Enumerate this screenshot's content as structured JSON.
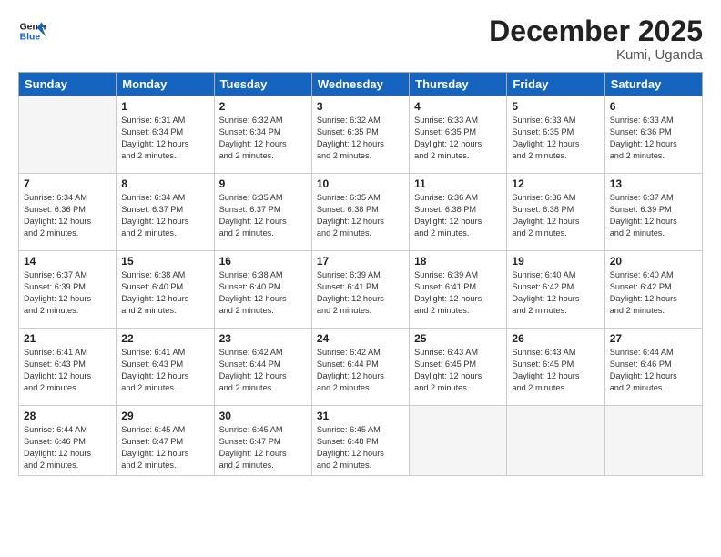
{
  "header": {
    "logo_line1": "General",
    "logo_line2": "Blue",
    "month_title": "December 2025",
    "location": "Kumi, Uganda"
  },
  "days_of_week": [
    "Sunday",
    "Monday",
    "Tuesday",
    "Wednesday",
    "Thursday",
    "Friday",
    "Saturday"
  ],
  "weeks": [
    [
      {
        "day": "",
        "empty": true
      },
      {
        "day": "1",
        "sunrise": "6:31 AM",
        "sunset": "6:34 PM",
        "daylight": "12 hours and 2 minutes."
      },
      {
        "day": "2",
        "sunrise": "6:32 AM",
        "sunset": "6:34 PM",
        "daylight": "12 hours and 2 minutes."
      },
      {
        "day": "3",
        "sunrise": "6:32 AM",
        "sunset": "6:35 PM",
        "daylight": "12 hours and 2 minutes."
      },
      {
        "day": "4",
        "sunrise": "6:33 AM",
        "sunset": "6:35 PM",
        "daylight": "12 hours and 2 minutes."
      },
      {
        "day": "5",
        "sunrise": "6:33 AM",
        "sunset": "6:35 PM",
        "daylight": "12 hours and 2 minutes."
      },
      {
        "day": "6",
        "sunrise": "6:33 AM",
        "sunset": "6:36 PM",
        "daylight": "12 hours and 2 minutes."
      }
    ],
    [
      {
        "day": "7",
        "sunrise": "6:34 AM",
        "sunset": "6:36 PM",
        "daylight": "12 hours and 2 minutes."
      },
      {
        "day": "8",
        "sunrise": "6:34 AM",
        "sunset": "6:37 PM",
        "daylight": "12 hours and 2 minutes."
      },
      {
        "day": "9",
        "sunrise": "6:35 AM",
        "sunset": "6:37 PM",
        "daylight": "12 hours and 2 minutes."
      },
      {
        "day": "10",
        "sunrise": "6:35 AM",
        "sunset": "6:38 PM",
        "daylight": "12 hours and 2 minutes."
      },
      {
        "day": "11",
        "sunrise": "6:36 AM",
        "sunset": "6:38 PM",
        "daylight": "12 hours and 2 minutes."
      },
      {
        "day": "12",
        "sunrise": "6:36 AM",
        "sunset": "6:38 PM",
        "daylight": "12 hours and 2 minutes."
      },
      {
        "day": "13",
        "sunrise": "6:37 AM",
        "sunset": "6:39 PM",
        "daylight": "12 hours and 2 minutes."
      }
    ],
    [
      {
        "day": "14",
        "sunrise": "6:37 AM",
        "sunset": "6:39 PM",
        "daylight": "12 hours and 2 minutes."
      },
      {
        "day": "15",
        "sunrise": "6:38 AM",
        "sunset": "6:40 PM",
        "daylight": "12 hours and 2 minutes."
      },
      {
        "day": "16",
        "sunrise": "6:38 AM",
        "sunset": "6:40 PM",
        "daylight": "12 hours and 2 minutes."
      },
      {
        "day": "17",
        "sunrise": "6:39 AM",
        "sunset": "6:41 PM",
        "daylight": "12 hours and 2 minutes."
      },
      {
        "day": "18",
        "sunrise": "6:39 AM",
        "sunset": "6:41 PM",
        "daylight": "12 hours and 2 minutes."
      },
      {
        "day": "19",
        "sunrise": "6:40 AM",
        "sunset": "6:42 PM",
        "daylight": "12 hours and 2 minutes."
      },
      {
        "day": "20",
        "sunrise": "6:40 AM",
        "sunset": "6:42 PM",
        "daylight": "12 hours and 2 minutes."
      }
    ],
    [
      {
        "day": "21",
        "sunrise": "6:41 AM",
        "sunset": "6:43 PM",
        "daylight": "12 hours and 2 minutes."
      },
      {
        "day": "22",
        "sunrise": "6:41 AM",
        "sunset": "6:43 PM",
        "daylight": "12 hours and 2 minutes."
      },
      {
        "day": "23",
        "sunrise": "6:42 AM",
        "sunset": "6:44 PM",
        "daylight": "12 hours and 2 minutes."
      },
      {
        "day": "24",
        "sunrise": "6:42 AM",
        "sunset": "6:44 PM",
        "daylight": "12 hours and 2 minutes."
      },
      {
        "day": "25",
        "sunrise": "6:43 AM",
        "sunset": "6:45 PM",
        "daylight": "12 hours and 2 minutes."
      },
      {
        "day": "26",
        "sunrise": "6:43 AM",
        "sunset": "6:45 PM",
        "daylight": "12 hours and 2 minutes."
      },
      {
        "day": "27",
        "sunrise": "6:44 AM",
        "sunset": "6:46 PM",
        "daylight": "12 hours and 2 minutes."
      }
    ],
    [
      {
        "day": "28",
        "sunrise": "6:44 AM",
        "sunset": "6:46 PM",
        "daylight": "12 hours and 2 minutes."
      },
      {
        "day": "29",
        "sunrise": "6:45 AM",
        "sunset": "6:47 PM",
        "daylight": "12 hours and 2 minutes."
      },
      {
        "day": "30",
        "sunrise": "6:45 AM",
        "sunset": "6:47 PM",
        "daylight": "12 hours and 2 minutes."
      },
      {
        "day": "31",
        "sunrise": "6:45 AM",
        "sunset": "6:48 PM",
        "daylight": "12 hours and 2 minutes."
      },
      {
        "day": "",
        "empty": true
      },
      {
        "day": "",
        "empty": true
      },
      {
        "day": "",
        "empty": true
      }
    ]
  ],
  "labels": {
    "sunrise": "Sunrise:",
    "sunset": "Sunset:",
    "daylight": "Daylight:"
  }
}
